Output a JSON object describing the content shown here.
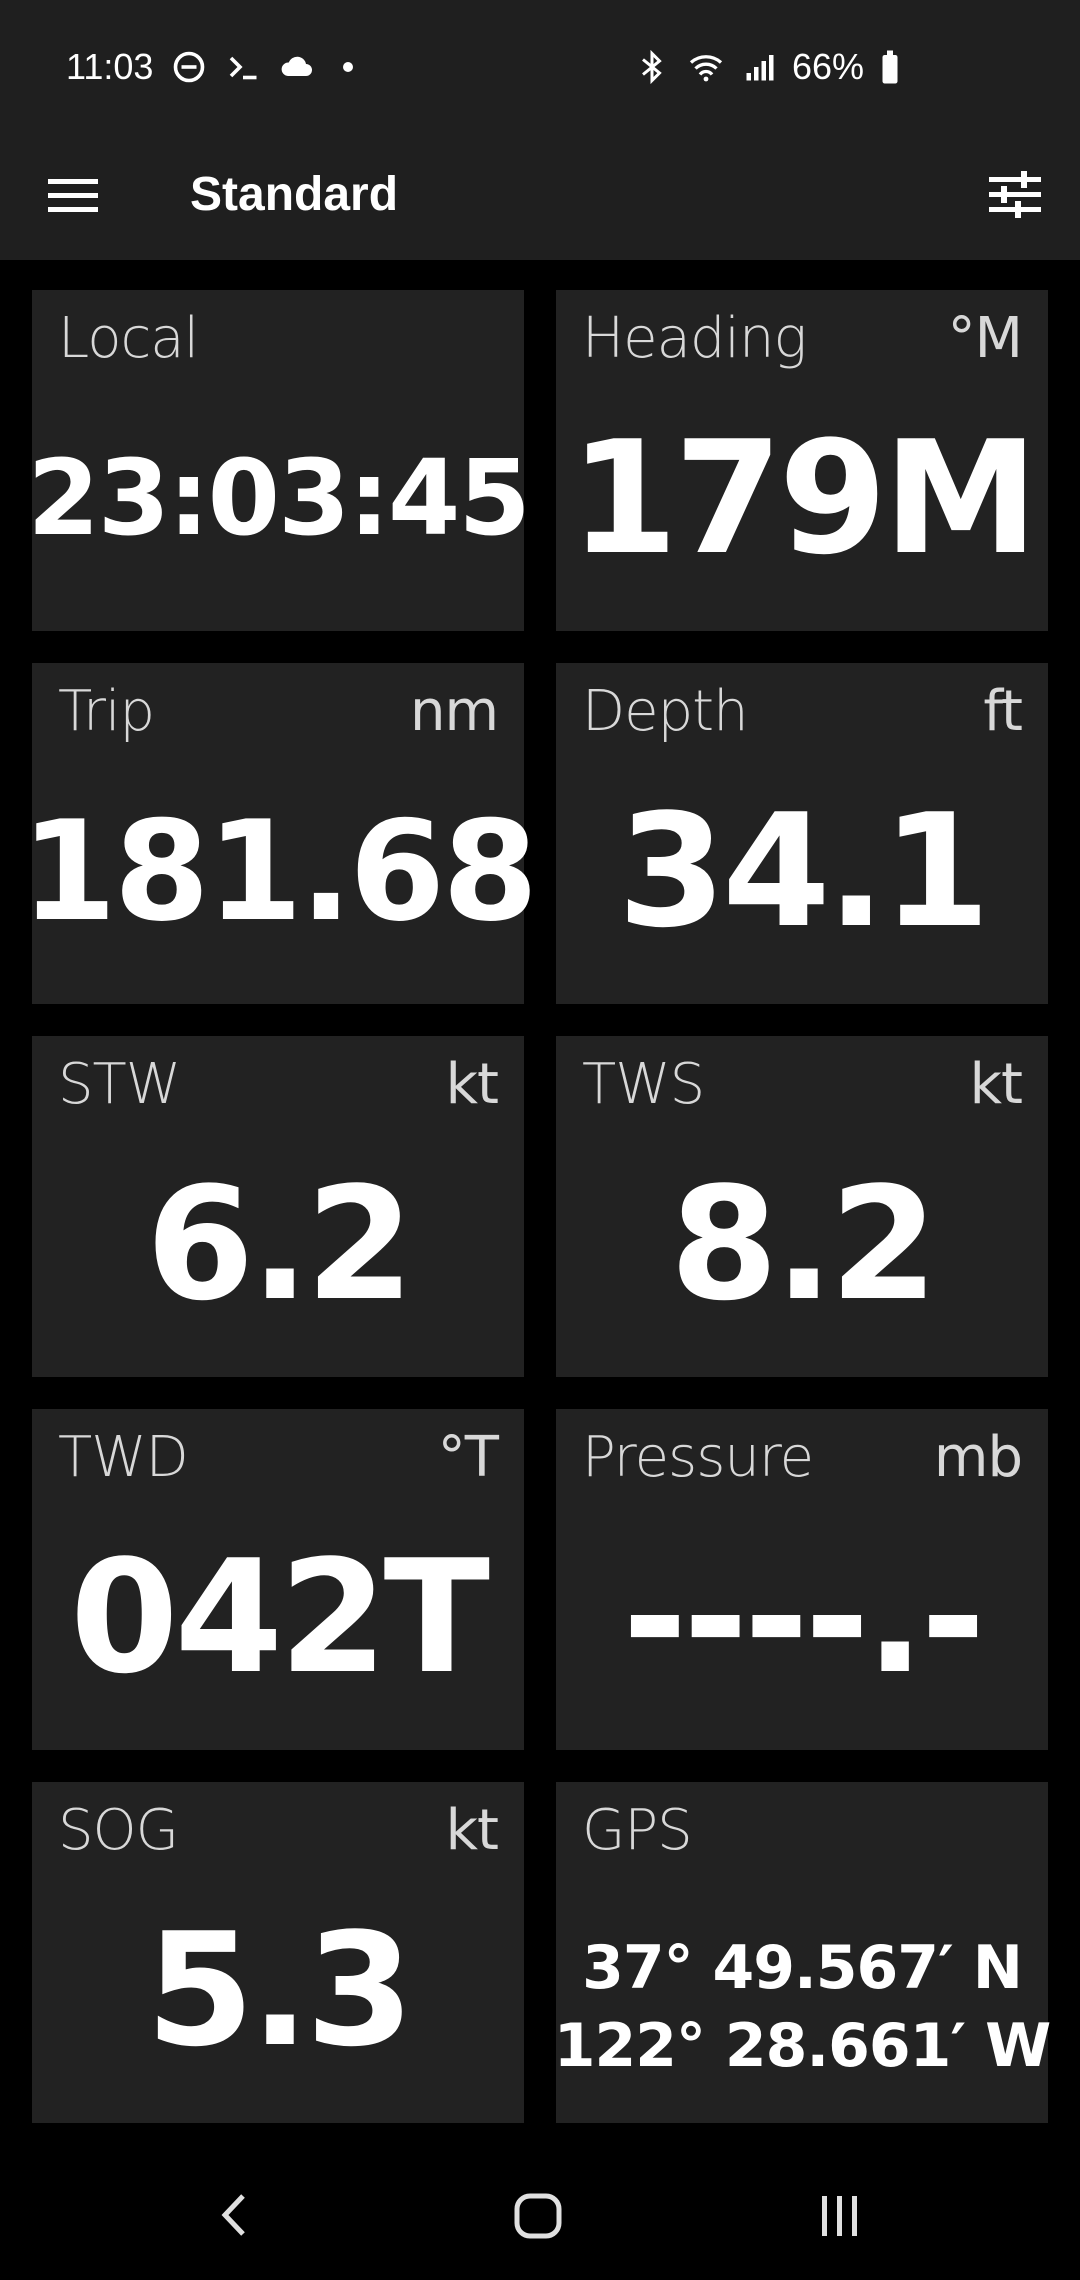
{
  "status_bar": {
    "time": "11:03",
    "battery_percent": "66%",
    "icons": [
      "dnd-icon",
      "terminal-icon",
      "cloud-icon",
      "notification-dot",
      "bluetooth-icon",
      "wifi-icon",
      "signal-icon",
      "battery-icon"
    ]
  },
  "app_bar": {
    "title": "Standard",
    "menu_icon": "hamburger-menu-icon",
    "settings_icon": "tune-icon"
  },
  "tiles": [
    {
      "label": "Local",
      "unit": "",
      "value": "23:03:45"
    },
    {
      "label": "Heading",
      "unit": "°M",
      "value": "179M"
    },
    {
      "label": "Trip",
      "unit": "nm",
      "value": "181.68"
    },
    {
      "label": "Depth",
      "unit": "ft",
      "value": "34.1"
    },
    {
      "label": "STW",
      "unit": "kt",
      "value": "6.2"
    },
    {
      "label": "TWS",
      "unit": "kt",
      "value": "8.2"
    },
    {
      "label": "TWD",
      "unit": "°T",
      "value": "042T"
    },
    {
      "label": "Pressure",
      "unit": "mb",
      "value": "----.-"
    },
    {
      "label": "SOG",
      "unit": "kt",
      "value": "5.3"
    },
    {
      "label": "GPS",
      "unit": "",
      "value_lines": [
        "37° 49.567′ N",
        "122° 28.661′ W"
      ]
    }
  ],
  "nav_bar": {
    "back": "back-icon",
    "home": "home-icon",
    "recents": "recents-icon"
  },
  "colors": {
    "background": "#000000",
    "bar": "#1f1f1f",
    "tile": "#222222",
    "text": "#ffffff",
    "label": "#d8d8d8"
  }
}
